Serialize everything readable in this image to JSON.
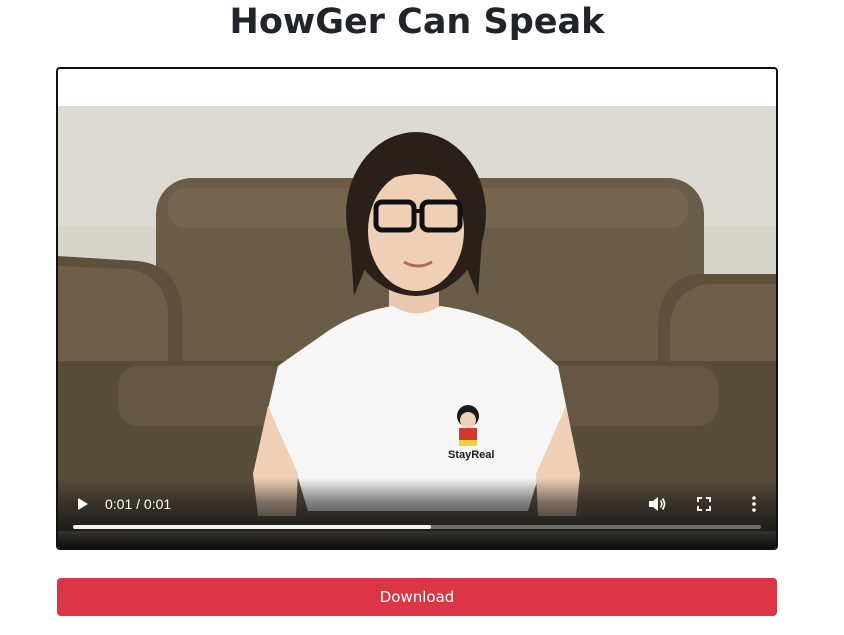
{
  "page": {
    "title": "HowGer Can Speak"
  },
  "video": {
    "time_display": "0:01 / 0:01",
    "progress_fraction": 0.52,
    "shirt_text": "StayReal"
  },
  "icons": {
    "play": "play-icon",
    "volume": "volume-icon",
    "fullscreen": "fullscreen-icon",
    "more": "more-options-icon"
  },
  "download": {
    "label": "Download"
  },
  "colors": {
    "download_button": "#dc3545",
    "title_text": "#212529"
  }
}
